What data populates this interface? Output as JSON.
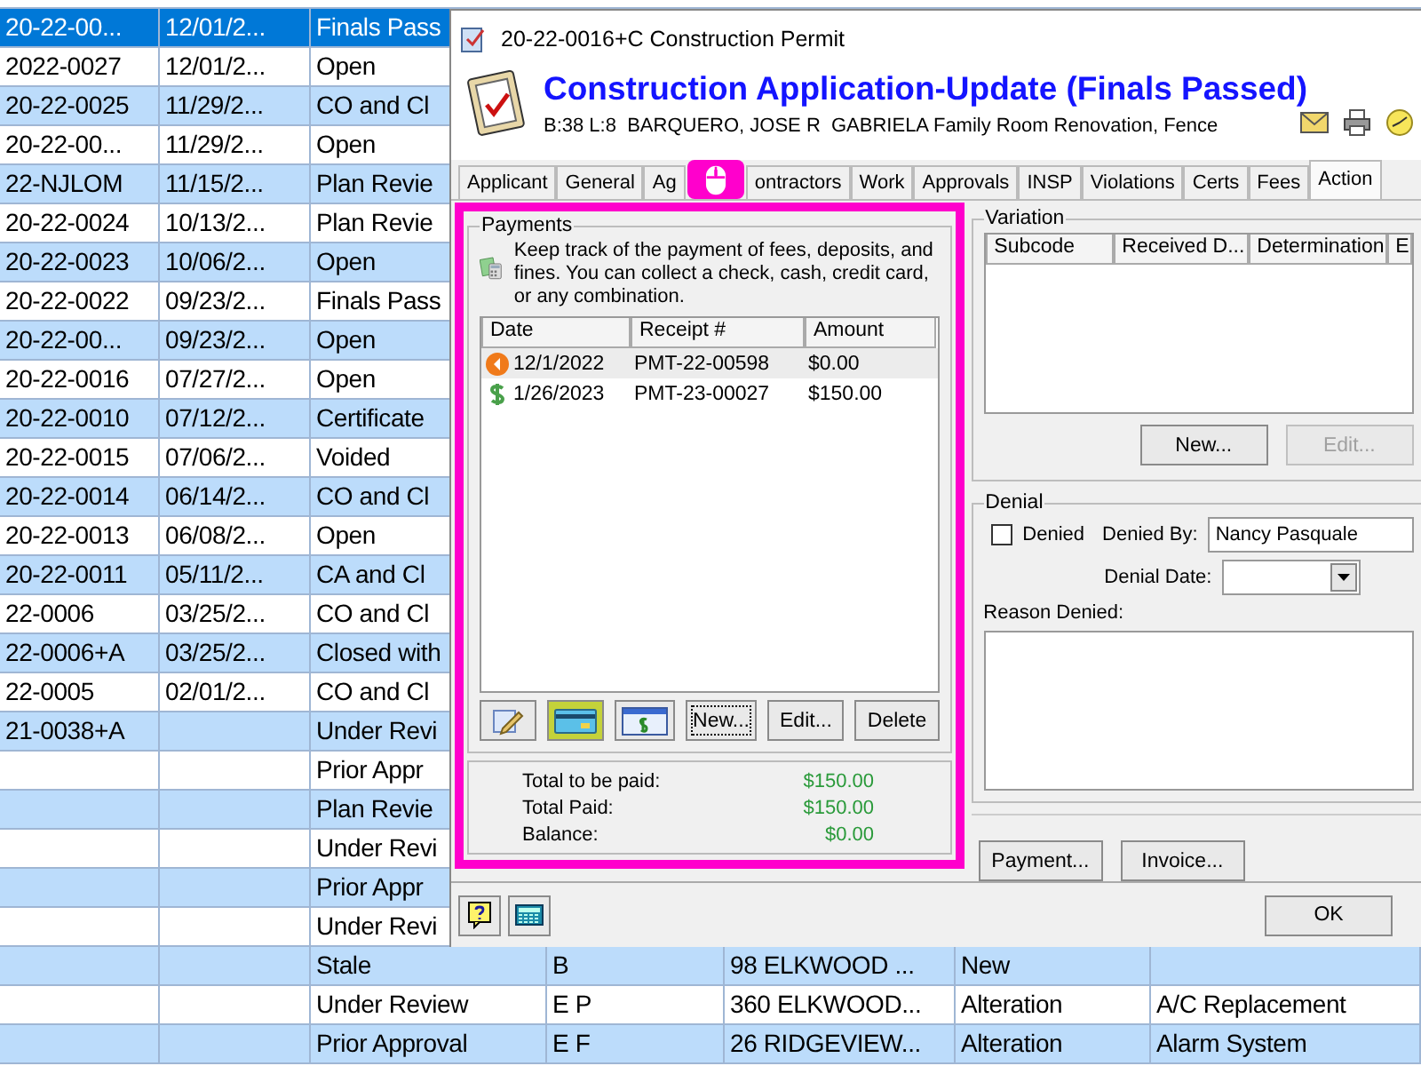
{
  "table": {
    "rows": [
      {
        "col_1": "20-22-00...",
        "col_2": "12/01/2...",
        "col_3": "Finals Pass",
        "selected": true
      },
      {
        "col_1": "2022-0027",
        "col_2": "12/01/2...",
        "col_3": "Open",
        "selected": false
      },
      {
        "col_1": "20-22-0025",
        "col_2": "11/29/2...",
        "col_3": "CO and Cl",
        "selected": false
      },
      {
        "col_1": "20-22-00...",
        "col_2": "11/29/2...",
        "col_3": "Open",
        "selected": false
      },
      {
        "col_1": "22-NJLOM",
        "col_2": "11/15/2...",
        "col_3": "Plan Revie",
        "selected": false
      },
      {
        "col_1": "20-22-0024",
        "col_2": "10/13/2...",
        "col_3": "Plan Revie",
        "selected": false
      },
      {
        "col_1": "20-22-0023",
        "col_2": "10/06/2...",
        "col_3": "Open",
        "selected": false
      },
      {
        "col_1": "20-22-0022",
        "col_2": "09/23/2...",
        "col_3": "Finals Pass",
        "selected": false
      },
      {
        "col_1": "20-22-00...",
        "col_2": "09/23/2...",
        "col_3": "Open",
        "selected": false
      },
      {
        "col_1": "20-22-0016",
        "col_2": "07/27/2...",
        "col_3": "Open",
        "selected": false
      },
      {
        "col_1": "20-22-0010",
        "col_2": "07/12/2...",
        "col_3": "Certificate",
        "selected": false
      },
      {
        "col_1": "20-22-0015",
        "col_2": "07/06/2...",
        "col_3": "Voided",
        "selected": false
      },
      {
        "col_1": "20-22-0014",
        "col_2": "06/14/2...",
        "col_3": "CO and Cl",
        "selected": false
      },
      {
        "col_1": "20-22-0013",
        "col_2": "06/08/2...",
        "col_3": "Open",
        "selected": false
      },
      {
        "col_1": "20-22-0011",
        "col_2": "05/11/2...",
        "col_3": "CA and Cl",
        "selected": false
      },
      {
        "col_1": "22-0006",
        "col_2": "03/25/2...",
        "col_3": "CO and Cl",
        "selected": false
      },
      {
        "col_1": "22-0006+A",
        "col_2": "03/25/2...",
        "col_3": "Closed with",
        "selected": false
      },
      {
        "col_1": "22-0005",
        "col_2": "02/01/2...",
        "col_3": "CO and Cl",
        "selected": false
      },
      {
        "col_1": "21-0038+A",
        "col_3": "Under Revi",
        "selected": false
      },
      {
        "col_3": "Prior Appr",
        "selected": false
      },
      {
        "col_3": "Plan Revie",
        "selected": false
      },
      {
        "col_3": "Under Revi",
        "selected": false
      },
      {
        "col_3": "Prior Appr",
        "selected": false
      },
      {
        "col_3": "Under Revi",
        "selected": false
      },
      {
        "col_3": "Stale",
        "col_4": "B",
        "col_5": "98 ELKWOOD ...",
        "col_6": "New",
        "selected": false
      },
      {
        "col_3": "Under Review",
        "col_4": "E P",
        "col_5": "360 ELKWOOD...",
        "col_6": "Alteration",
        "col_7": "A/C Replacement",
        "selected": false
      },
      {
        "col_3": "Prior Approval",
        "col_4": "E F",
        "col_5": "26 RIDGEVIEW...",
        "col_6": "Alteration",
        "col_7": "Alarm System",
        "selected": false
      }
    ]
  },
  "dialog": {
    "title": "20-22-0016+C Construction Permit",
    "heading": "Construction Application-Update (Finals Passed)",
    "subtitle": "B:38 L:8  BARQUERO, JOSE R  GABRIELA Family Room Renovation, Fence",
    "tabs": [
      {
        "label": "Applicant",
        "selected": false
      },
      {
        "label": "General",
        "selected": false
      },
      {
        "label": "Ag",
        "selected": false
      },
      {
        "label": "ontractors",
        "selected": false
      },
      {
        "label": "Work",
        "selected": false
      },
      {
        "label": "Approvals",
        "selected": false
      },
      {
        "label": "INSP",
        "selected": false
      },
      {
        "label": "Violations",
        "selected": false
      },
      {
        "label": "Certs",
        "selected": false
      },
      {
        "label": "Fees",
        "selected": false
      },
      {
        "label": "Action",
        "selected": true
      }
    ],
    "payments": {
      "legend": "Payments",
      "description": "Keep track of the payment of fees, deposits, and fines. You can collect a check, cash, credit card, or any combination.",
      "columns": [
        "Date",
        "Receipt #",
        "Amount"
      ],
      "rows": [
        {
          "kind": "refund",
          "date": "12/1/2022",
          "receipt": "PMT-22-00598",
          "amount": "$0.00",
          "selected": true
        },
        {
          "kind": "payment",
          "date": "1/26/2023",
          "receipt": "PMT-23-00027",
          "amount": "$150.00",
          "selected": false
        }
      ],
      "buttons": [
        "New...",
        "Edit...",
        "Delete"
      ],
      "totals": [
        {
          "label": "Total to be paid:",
          "value": "$150.00"
        },
        {
          "label": "Total Paid:",
          "value": "$150.00"
        },
        {
          "label": "Balance:",
          "value": "$0.00"
        }
      ]
    },
    "variation": {
      "legend": "Variation",
      "columns": [
        "Subcode",
        "Received D...",
        "Determination",
        "E"
      ],
      "buttons": [
        {
          "label": "New...",
          "disabled": false
        },
        {
          "label": "Edit...",
          "disabled": true
        }
      ]
    },
    "denial": {
      "legend": "Denial",
      "denied": {
        "label": "Denied",
        "checked": false
      },
      "denied_by": {
        "label": "Denied By:",
        "value": "Nancy Pasquale"
      },
      "denial_date": {
        "label": "Denial Date:"
      },
      "reason": {
        "label": "Reason Denied:"
      }
    },
    "action_buttons": [
      "Payment...",
      "Invoice..."
    ],
    "ok": "OK"
  }
}
